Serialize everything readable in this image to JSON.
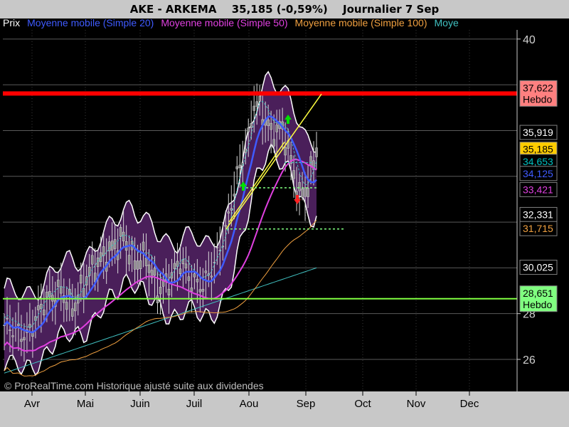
{
  "header": {
    "symbol": "AKE - ARKEMA",
    "price_change": "35,185 (-0,59%)",
    "period": "Journalier  7 Sep"
  },
  "legend": [
    {
      "label": "Prix",
      "color": "#ffffff"
    },
    {
      "label": "Moyenne mobile (Simple 20)",
      "color": "#3f5bff"
    },
    {
      "label": "Moyenne mobile (Simple 50)",
      "color": "#e040e0"
    },
    {
      "label": "Moyenne mobile (Simple 100)",
      "color": "#f0a040"
    },
    {
      "label": "Moye",
      "color": "#40c0c0"
    }
  ],
  "footer": "© ProRealTime.com Historique ajusté suite aux dividendes",
  "chart_data": {
    "type": "line",
    "months": [
      "Avr",
      "Mai",
      "Juin",
      "Juil",
      "Aou",
      "Sep",
      "Oct",
      "Nov",
      "Dec"
    ],
    "y_ticks": [
      "40",
      "28",
      "26"
    ],
    "ylim": [
      24.6,
      40.4
    ],
    "grid": true,
    "price_labels": [
      {
        "text": "37,622",
        "sub": "Hebdo",
        "bg": "#ff8080",
        "fg": "#000000",
        "value": 37.622
      },
      {
        "text": "35,919",
        "bg": "#000000",
        "fg": "#ffffff",
        "value": 35.919
      },
      {
        "text": "35,185",
        "bg": "#ffcc00",
        "fg": "#000000",
        "value": 35.185
      },
      {
        "text": "34,653",
        "bg": "#000000",
        "fg": "#00bfbf",
        "value": 34.653
      },
      {
        "text": "34,125",
        "bg": "#000000",
        "fg": "#3f5bff",
        "value": 34.125
      },
      {
        "text": "33,421",
        "bg": "#000000",
        "fg": "#e040e0",
        "value": 33.421
      },
      {
        "text": "32,331",
        "bg": "#000000",
        "fg": "#ffffff",
        "value": 32.331
      },
      {
        "text": "31,715",
        "bg": "#000000",
        "fg": "#f0a040",
        "value": 31.715
      },
      {
        "text": "30,025",
        "bg": "#000000",
        "fg": "#ffffff",
        "value": 30.025
      },
      {
        "text": "28,651",
        "sub": "Hebdo",
        "bg": "#80ff80",
        "fg": "#000000",
        "value": 28.651
      }
    ],
    "horizontal_lines": [
      {
        "value": 37.622,
        "color": "#ff0000"
      },
      {
        "value": 28.651,
        "color": "#80ff40"
      }
    ],
    "colors": {
      "bands": "#4a1f5a",
      "band_edge": "#ffffff",
      "ma20": "#3f5bff",
      "ma50": "#e040e0",
      "ma100": "#f0a040",
      "ma200": "#40c0c0",
      "candle": "#d8d8d8",
      "trendline": "#ffff40",
      "support": "#80ff80",
      "arrow_up": "#00e000",
      "arrow_down": "#ff2020"
    }
  }
}
